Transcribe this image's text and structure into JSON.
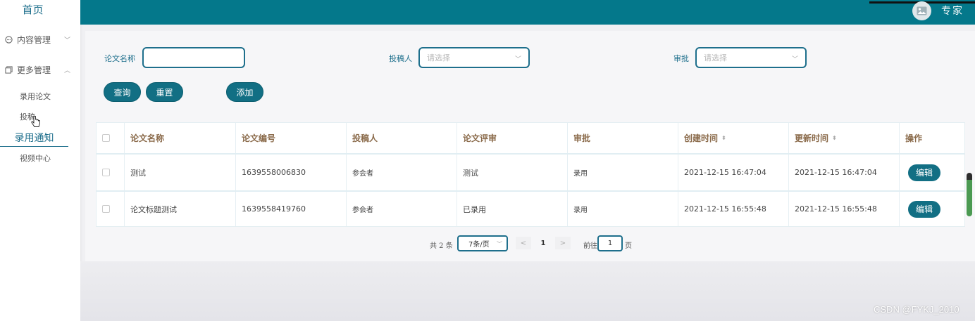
{
  "sidebar": {
    "home": "首页",
    "groups": [
      {
        "label": "内容管理",
        "icon": "chat-icon",
        "expanded": false
      },
      {
        "label": "更多管理",
        "icon": "copy-icon",
        "expanded": true
      }
    ],
    "items": [
      {
        "label": "录用论文"
      },
      {
        "label": "投稿"
      },
      {
        "label": "录用通知",
        "active": true
      },
      {
        "label": "视频中心"
      }
    ]
  },
  "header": {
    "user_name": "专家",
    "avatar_icon": "image-icon",
    "bar_color": "#04788b"
  },
  "search": {
    "title_label": "论文名称",
    "title_value": "",
    "author_label": "投稿人",
    "author_placeholder": "请选择",
    "approval_label": "审批",
    "approval_placeholder": "请选择"
  },
  "buttons": {
    "query": "查询",
    "reset": "重置",
    "add": "添加"
  },
  "table": {
    "headers": [
      "论文名称",
      "论文编号",
      "投稿人",
      "论文评审",
      "审批",
      "创建时间",
      "更新时间",
      "操作"
    ],
    "rows": [
      {
        "title": "测试",
        "number": "1639558006830",
        "author": "参会者",
        "review": "测试",
        "approval": "录用",
        "created": "2021-12-15 16:47:04",
        "updated": "2021-12-15 16:47:04",
        "action": "编辑"
      },
      {
        "title": "论文标题测试",
        "number": "1639558419760",
        "author": "参会者",
        "review": "已录用",
        "approval": "录用",
        "created": "2021-12-15 16:55:48",
        "updated": "2021-12-15 16:55:48",
        "action": "编辑"
      }
    ]
  },
  "pagination": {
    "total_text": "共 2 条",
    "page_size": "7条/页",
    "prev": "<",
    "current": "1",
    "next": ">",
    "goto_label": "前往",
    "goto_value": "1",
    "page_unit": "页"
  },
  "watermark": "CSDN @FYKJ_2010",
  "colors": {
    "accent": "#126f84",
    "text_accent": "#1e6f8c"
  }
}
